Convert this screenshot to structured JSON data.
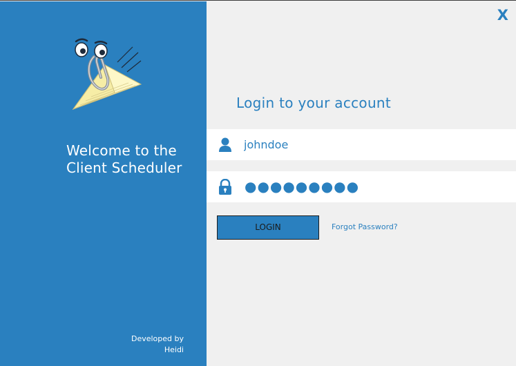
{
  "window": {
    "close_label": "X"
  },
  "sidebar": {
    "welcome_line1": "Welcome to the",
    "welcome_line2": "Client Scheduler",
    "credits_line1": "Developed by",
    "credits_line2": "Heidi",
    "mascot_icon": "paperclip-paper-plane-icon"
  },
  "login": {
    "title": "Login to your account",
    "username_value": "johndoe",
    "username_icon": "user-icon",
    "password_masked": "●●●●●●●●●",
    "password_icon": "lock-icon",
    "login_label": "LOGIN",
    "forgot_label": "Forgot Password?"
  },
  "colors": {
    "accent": "#2a80bf",
    "panel_bg": "#f0f0f0",
    "field_bg": "#ffffff"
  }
}
